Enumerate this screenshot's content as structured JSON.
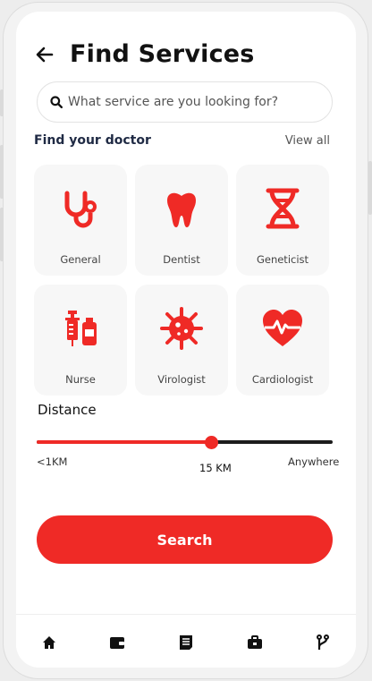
{
  "header": {
    "title": "Find Services",
    "back_icon": "arrow-left-icon"
  },
  "search": {
    "placeholder": "What service are you looking for?",
    "value": ""
  },
  "section": {
    "title": "Find your doctor",
    "view_all": "View all"
  },
  "services": [
    {
      "label": "General",
      "icon": "stethoscope-icon"
    },
    {
      "label": "Dentist",
      "icon": "tooth-icon"
    },
    {
      "label": "Geneticist",
      "icon": "dna-icon"
    },
    {
      "label": "Nurse",
      "icon": "syringe-icon"
    },
    {
      "label": "Virologist",
      "icon": "virus-icon"
    },
    {
      "label": "Cardiologist",
      "icon": "heartbeat-icon"
    }
  ],
  "distance": {
    "label": "Distance",
    "min_label": "<1KM",
    "value_label": "15 KM",
    "max_label": "Anywhere",
    "fraction": 0.59
  },
  "search_button": {
    "label": "Search"
  },
  "bottom_nav": [
    "home-icon",
    "wallet-icon",
    "receipt-icon",
    "briefcase-icon",
    "branch-icon"
  ],
  "colors": {
    "accent": "#ef2a26",
    "text_dark": "#111111",
    "card_bg": "#f7f7f7"
  }
}
